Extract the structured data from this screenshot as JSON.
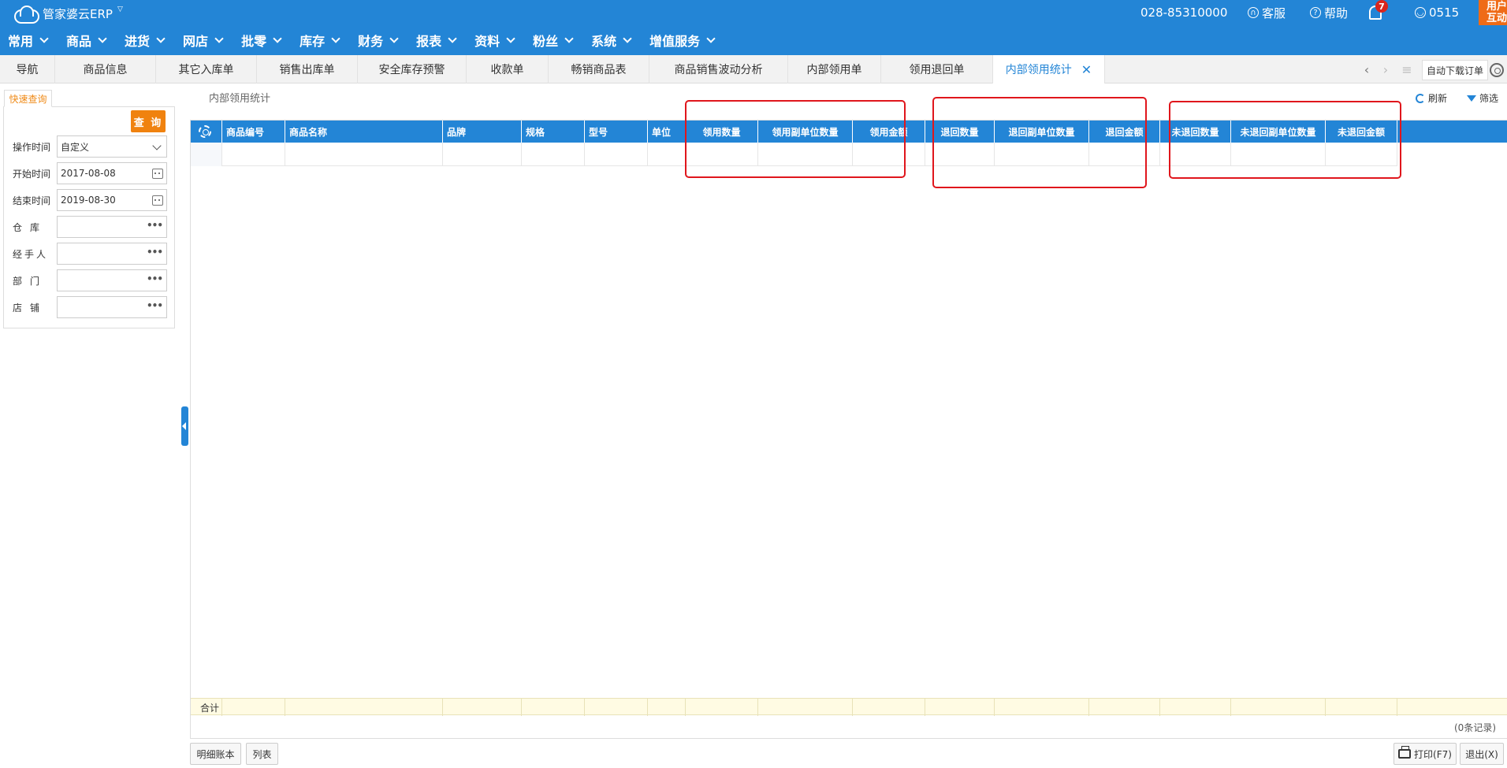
{
  "app": {
    "logo_text": "管家婆云ERP",
    "phone": "028-85310000",
    "kefu": "客服",
    "help": "帮助",
    "notification_count": "7",
    "user": "0515",
    "promo": "用户互动"
  },
  "mainnav": [
    "常用",
    "商品",
    "进货",
    "网店",
    "批零",
    "库存",
    "财务",
    "报表",
    "资料",
    "粉丝",
    "系统",
    "增值服务"
  ],
  "tabs": [
    "导航",
    "商品信息",
    "其它入库单",
    "销售出库单",
    "安全库存预警",
    "收款单",
    "畅销商品表",
    "商品销售波动分析",
    "内部领用单",
    "领用退回单",
    "内部领用统计"
  ],
  "tab_tools": {
    "auto_download": "自动下载订单"
  },
  "query": {
    "tab_label": "快速查询",
    "button": "查 询",
    "fields": [
      {
        "label": "操作时间",
        "value": "自定义"
      },
      {
        "label": "开始时间",
        "value": "2017-08-08"
      },
      {
        "label": "结束时间",
        "value": "2019-08-30"
      },
      {
        "label": "仓库",
        "value": ""
      },
      {
        "label": "经手人",
        "value": ""
      },
      {
        "label": "部门",
        "value": ""
      },
      {
        "label": "店铺",
        "value": ""
      }
    ]
  },
  "main": {
    "title": "内部领用统计",
    "refresh": "刷新",
    "filter": "筛选",
    "columns": [
      "商品编号",
      "商品名称",
      "品牌",
      "规格",
      "型号",
      "单位",
      "领用数量",
      "领用副单位数量",
      "领用金额",
      "退回数量",
      "退回副单位数量",
      "退回金额",
      "未退回数量",
      "未退回副单位数量",
      "未退回金额"
    ],
    "sum_label": "合计",
    "records": "(0条记录)"
  },
  "bottom": {
    "detail": "明细账本",
    "list": "列表",
    "print": "打印(F7)",
    "exit": "退出(X)"
  }
}
